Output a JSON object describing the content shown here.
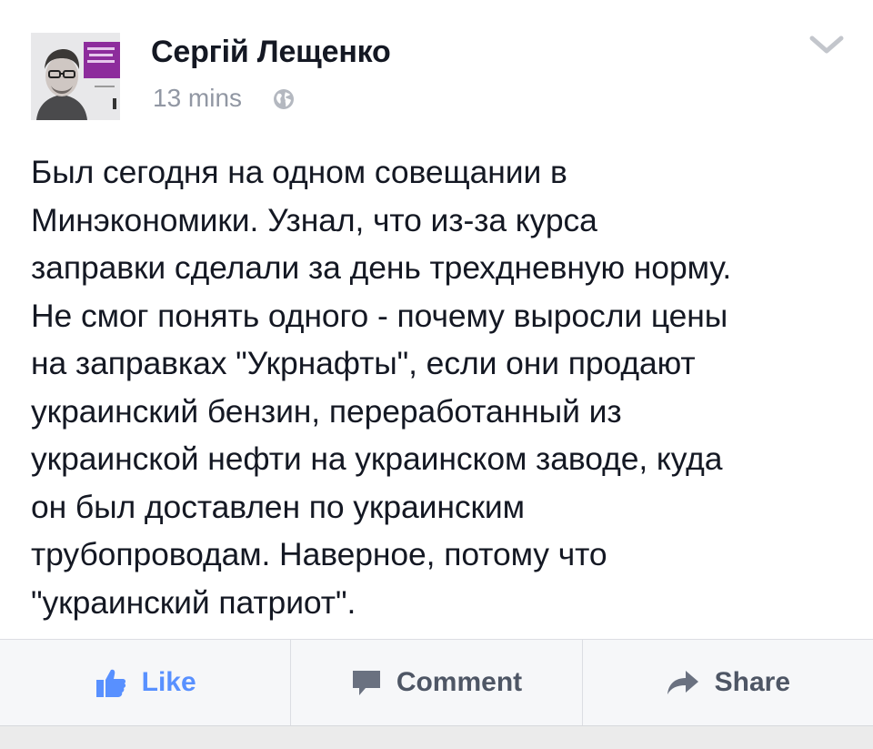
{
  "post": {
    "author": "Сергій Лещенко",
    "timestamp": "13 mins",
    "privacy_icon": "globe-icon",
    "text": "Был сегодня на одном совещании в\nМинэкономики. Узнал, что из-за курса\nзаправки сделали за день трехдневную норму.\nНе смог понять одного - почему выросли цены\nна заправках \"Укрнафты\", если они продают\nукраинский бензин, переработанный из\nукраинской нефти на украинском заводе, куда\nон был доставлен по украинским\nтрубопроводам. Наверное, потому что\n\"украинский патриот\"."
  },
  "actions": {
    "like": "Like",
    "comment": "Comment",
    "share": "Share"
  },
  "colors": {
    "like_accent": "#5890ff",
    "action_text": "#4e5665",
    "brand_purple": "#8d2c9c"
  }
}
